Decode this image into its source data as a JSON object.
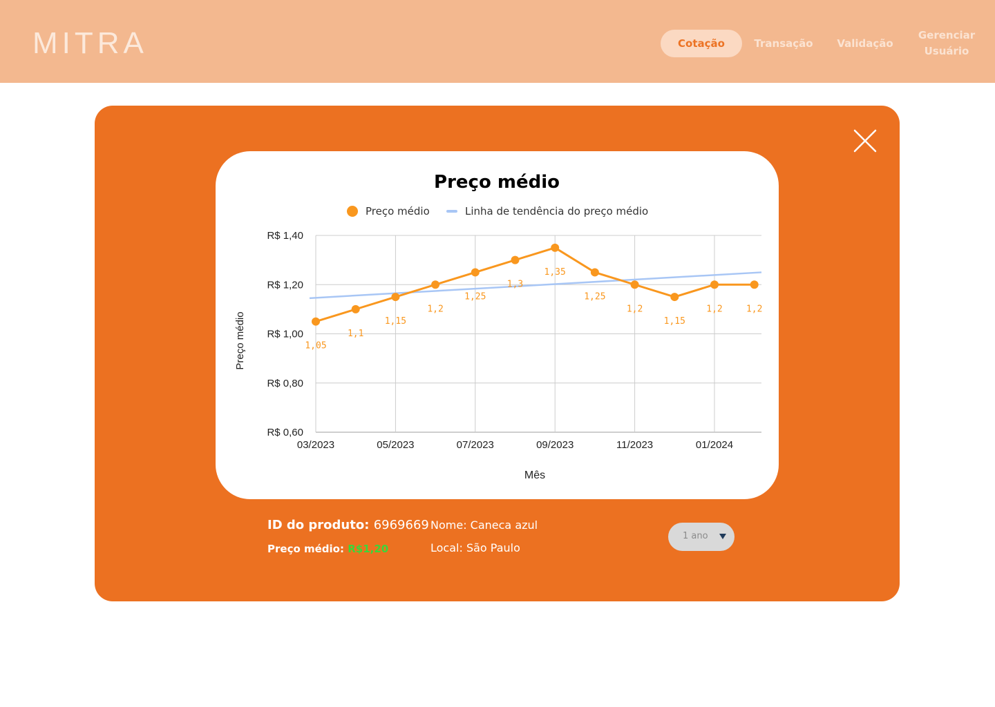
{
  "header": {
    "logo": "MITRA",
    "nav": [
      {
        "label": "Cotação",
        "active": true
      },
      {
        "label": "Transação",
        "active": false
      },
      {
        "label": "Validação",
        "active": false
      },
      {
        "label_line1": "Gerenciar",
        "label_line2": "Usuário",
        "active": false
      }
    ]
  },
  "modal": {
    "close_icon": "close-icon",
    "product": {
      "id_label": "ID do produto:",
      "id_value": "6969669",
      "price_label": "Preço médio:",
      "price_value": "R$1,20",
      "name": "Nome: Caneca azul",
      "local": "Local: São Paulo"
    },
    "period_select": {
      "selected": "1 ano",
      "icon": "caret-down-icon"
    }
  },
  "colors": {
    "accent": "#EC7121",
    "header_bg": "#F3B88F",
    "series": "#F9971E",
    "trend": "#A8C6F5",
    "price_value": "#3CD63A"
  },
  "chart_data": {
    "type": "line",
    "title": "Preço médio",
    "xlabel": "Mês",
    "ylabel": "Preço médio",
    "x": [
      "03/2023",
      "04/2023",
      "05/2023",
      "06/2023",
      "07/2023",
      "08/2023",
      "09/2023",
      "10/2023",
      "11/2023",
      "12/2023",
      "01/2024",
      "02/2024"
    ],
    "x_tick_labels": [
      "03/2023",
      "05/2023",
      "07/2023",
      "09/2023",
      "11/2023",
      "01/2024"
    ],
    "ylim": [
      0.6,
      1.4
    ],
    "y_ticks": [
      0.6,
      0.8,
      1.0,
      1.2,
      1.4
    ],
    "y_tick_labels": [
      "R$ 0,60",
      "R$ 0,80",
      "R$ 1,00",
      "R$ 1,20",
      "R$ 1,40"
    ],
    "series": [
      {
        "name": "Preço médio",
        "values": [
          1.05,
          1.1,
          1.15,
          1.2,
          1.25,
          1.3,
          1.35,
          1.25,
          1.2,
          1.15,
          1.2,
          1.2
        ],
        "data_labels": [
          "1,05",
          "1,1",
          "1,15",
          "1,2",
          "1,25",
          "1,3",
          "1,35",
          "1,25",
          "1,2",
          "1,15",
          "1,2",
          "1,2"
        ]
      },
      {
        "name": "Linha de tendência do preço médio",
        "type": "trendline",
        "start": 1.145,
        "end": 1.25
      }
    ],
    "grid": true,
    "legend": "top"
  }
}
